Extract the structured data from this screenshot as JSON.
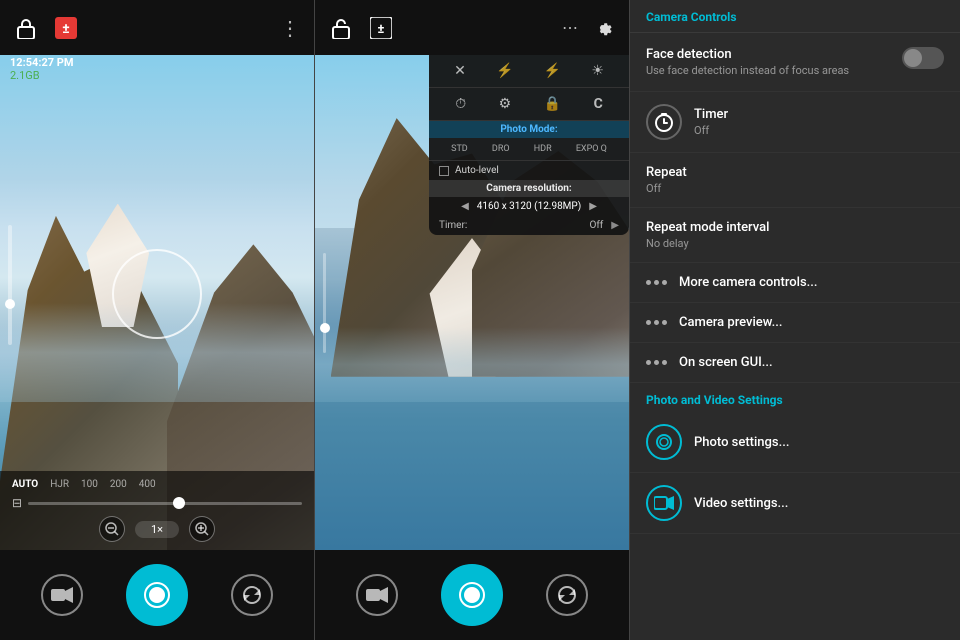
{
  "left_phone": {
    "topbar": {
      "time": "12:54:27 PM",
      "storage": "2.1GB",
      "icons": [
        "lock",
        "exposure-red",
        "more"
      ]
    },
    "iso_options": [
      "AUTO",
      "HJR",
      "100",
      "200",
      "400"
    ],
    "iso_active": "AUTO"
  },
  "middle_phone": {
    "topbar": {
      "icons": [
        "lock",
        "exposure",
        "more",
        "gear"
      ]
    },
    "dropdown": {
      "mode_row": [
        "STD",
        "DRO",
        "HDR",
        "EXPO"
      ],
      "section_title": "Photo Mode:",
      "auto_level_label": "Auto-level",
      "resolution_title": "Camera resolution:",
      "resolution_value": "4160 x 3120 (12.98MP)",
      "timer_label": "Timer:",
      "timer_value": "Off"
    }
  },
  "settings_panel": {
    "section1_title": "Camera Controls",
    "face_detection_label": "Face detection",
    "face_detection_sub": "Use face detection instead of focus areas",
    "face_detection_enabled": false,
    "timer_label": "Timer",
    "timer_value": "Off",
    "repeat_label": "Repeat",
    "repeat_value": "Off",
    "repeat_interval_label": "Repeat mode interval",
    "repeat_interval_value": "No delay",
    "more_camera_label": "More camera controls...",
    "camera_preview_label": "Camera preview...",
    "on_screen_gui_label": "On screen GUI...",
    "section2_title": "Photo and Video Settings",
    "photo_settings_label": "Photo settings...",
    "video_settings_label": "Video settings..."
  }
}
